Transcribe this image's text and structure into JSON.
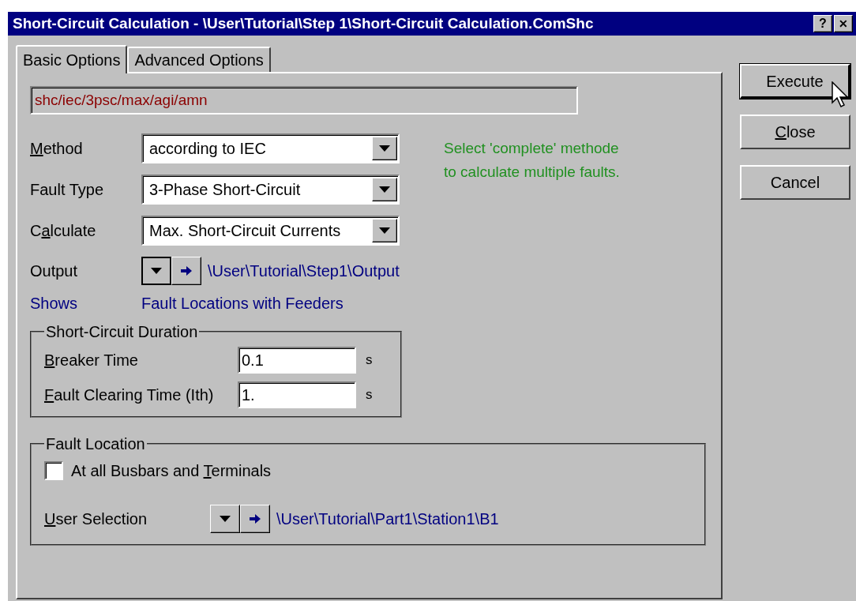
{
  "window": {
    "title": "Short-Circuit Calculation - \\User\\Tutorial\\Step 1\\Short-Circuit Calculation.ComShc",
    "help": "?",
    "close": "✕"
  },
  "tabs": [
    {
      "label": "Basic Options",
      "selected": true
    },
    {
      "label": "Advanced Options",
      "selected": false
    }
  ],
  "command_string": "shc/iec/3psc/max/agi/amn",
  "fields": [
    {
      "label": {
        "access_key": "M",
        "after": "ethod"
      },
      "value": "according to IEC"
    },
    {
      "label": "Fault Type",
      "value": "3-Phase Short-Circuit"
    },
    {
      "label": {
        "before": "C",
        "access_key": "a",
        "after": "lculate"
      },
      "value": "Max. Short-Circuit Currents"
    }
  ],
  "note": [
    "Select 'complete' methode",
    "to calculate multiple faults."
  ],
  "output": {
    "label": "Output",
    "path": "\\User\\Tutorial\\Step1\\Output"
  },
  "shows": {
    "label": "Shows",
    "value": "Fault Locations with Feeders"
  },
  "duration": {
    "title": "Short-Circuit Duration",
    "rows": [
      {
        "label": {
          "access_key": "B",
          "after": "reaker Time"
        },
        "value": "0.1",
        "unit": "s"
      },
      {
        "label": {
          "access_key": "F",
          "after": "ault Clearing Time (Ith)"
        },
        "value": "1.",
        "unit": "s"
      }
    ]
  },
  "fault_location": {
    "title": "Fault Location",
    "checkbox": {
      "label": {
        "before": "At all Busbars and ",
        "access_key": "T",
        "after": "erminals"
      },
      "checked": false
    },
    "user_selection": {
      "label": {
        "access_key": "U",
        "after": "ser Selection"
      },
      "path": "\\User\\Tutorial\\Part1\\Station1\\B1"
    }
  },
  "buttons": [
    {
      "label": "Execute",
      "default": true
    },
    {
      "label": {
        "access_key": "C",
        "after": "lose"
      },
      "default": false
    },
    {
      "label": "Cancel",
      "default": false
    }
  ]
}
